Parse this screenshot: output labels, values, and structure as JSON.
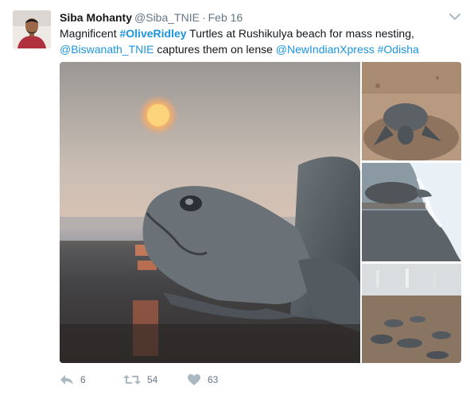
{
  "tweet": {
    "author_name": "Siba Mohanty",
    "author_handle": "@Siba_TNIE",
    "separator": "·",
    "date": "Feb 16",
    "text_parts": {
      "p1": "Magnificent ",
      "tag_olive": "#OliveRidley",
      "p2": " Turtles at Rushikulya beach for mass nesting,",
      "mention_biswanath": "@Biswanath_TNIE",
      "p3": " captures them on lense ",
      "mention_nix": "@NewIndianXpress",
      "p4": " ",
      "tag_odisha": "#Odisha"
    },
    "actions": {
      "reply_count": "6",
      "retweet_count": "54",
      "like_count": "63"
    }
  },
  "icons": {
    "caret": "chevron-down-icon",
    "reply": "reply-icon",
    "retweet": "retweet-icon",
    "like": "heart-icon"
  },
  "colors": {
    "link": "#1b95e0",
    "secondary_text": "#657786",
    "primary_text": "#14171a"
  }
}
